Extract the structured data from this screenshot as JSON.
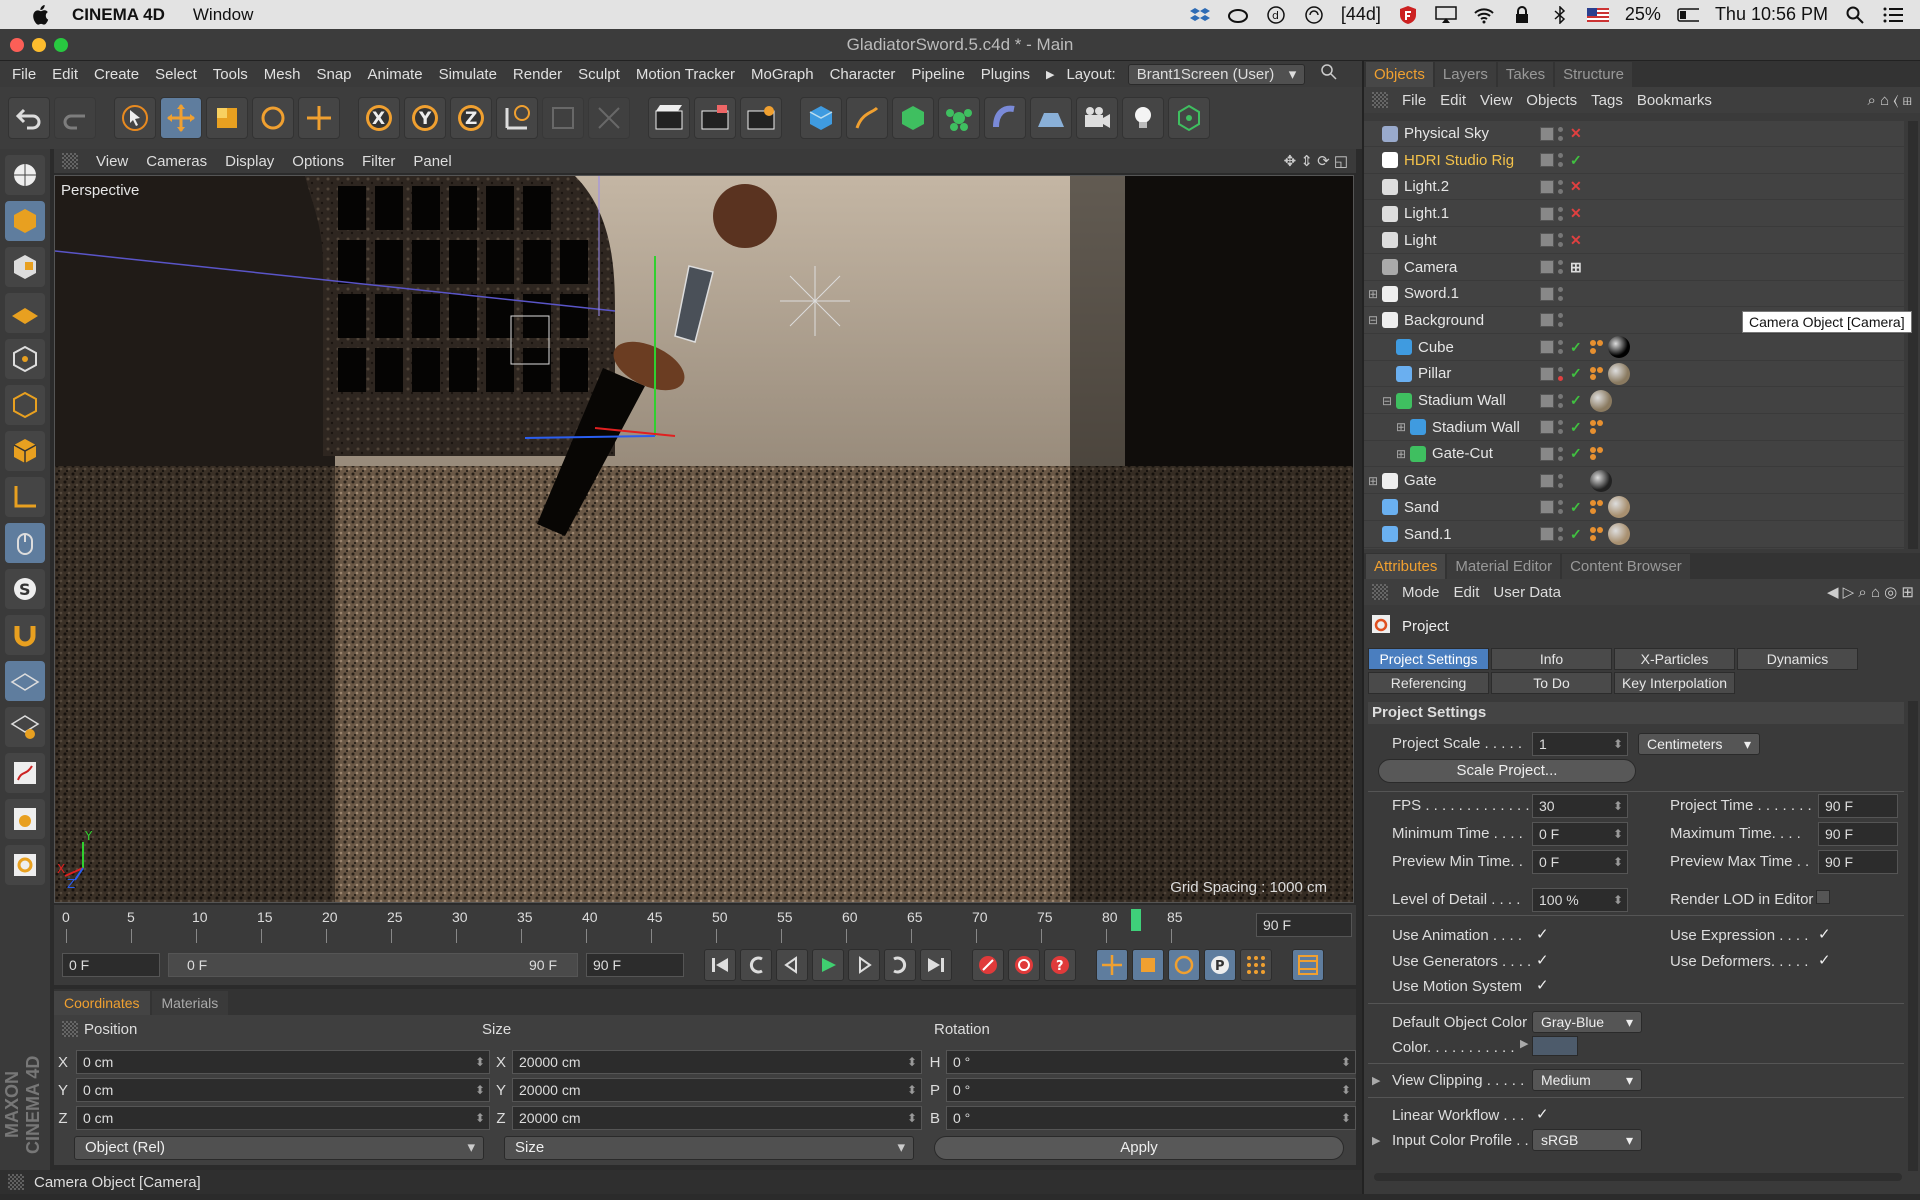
{
  "mac_menu": {
    "app_name": "CINEMA 4D",
    "window_menu": "Window",
    "status_44d": "[44d]",
    "battery": "25%",
    "clock": "Thu 10:56 PM"
  },
  "window": {
    "title": "GladiatorSword.5.c4d * - Main"
  },
  "main_menu": {
    "items": [
      "File",
      "Edit",
      "Create",
      "Select",
      "Tools",
      "Mesh",
      "Snap",
      "Animate",
      "Simulate",
      "Render",
      "Sculpt",
      "Motion Tracker",
      "MoGraph",
      "Character",
      "Pipeline",
      "Plugins"
    ],
    "layout_label": "Layout:",
    "layout_value": "Brant1Screen (User)"
  },
  "viewport_menu": {
    "items": [
      "View",
      "Cameras",
      "Display",
      "Options",
      "Filter",
      "Panel"
    ]
  },
  "viewport": {
    "label": "Perspective",
    "grid_spacing": "Grid Spacing : 1000 cm",
    "axis_y": "Y",
    "axis_x": "X",
    "axis_z": "Z"
  },
  "timeline": {
    "ticks": [
      "0",
      "5",
      "10",
      "15",
      "20",
      "25",
      "30",
      "35",
      "40",
      "45",
      "50",
      "55",
      "60",
      "65",
      "70",
      "75",
      "80",
      "85"
    ],
    "end_frame": "90 F",
    "current_frame_fraction": 0.91
  },
  "transport": {
    "start_field": "0 F",
    "range_start": "0 F",
    "range_end": "90 F",
    "end_field": "90 F"
  },
  "coord_tabs": {
    "coordinates": "Coordinates",
    "materials": "Materials"
  },
  "coords": {
    "position_header": "Position",
    "size_header": "Size",
    "rotation_header": "Rotation",
    "pos_labels": [
      "X",
      "Y",
      "Z"
    ],
    "pos_values": [
      "0 cm",
      "0 cm",
      "0 cm"
    ],
    "size_labels": [
      "X",
      "Y",
      "Z"
    ],
    "size_values": [
      "20000 cm",
      "20000 cm",
      "20000 cm"
    ],
    "rot_labels": [
      "H",
      "P",
      "B"
    ],
    "rot_values": [
      "0 °",
      "0 °",
      "0 °"
    ],
    "mode_dropdown": "Object (Rel)",
    "size_dropdown": "Size",
    "apply": "Apply"
  },
  "status": {
    "text": "Camera Object [Camera]"
  },
  "maxon": "MAXON CINEMA 4D",
  "objects_panel": {
    "tabs": [
      "Objects",
      "Layers",
      "Takes",
      "Structure"
    ],
    "menu": [
      "File",
      "Edit",
      "View",
      "Objects",
      "Tags",
      "Bookmarks"
    ],
    "rows": [
      {
        "name": "Physical Sky",
        "state": "✕",
        "state_color": "#e04040"
      },
      {
        "name": "HDRI Studio Rig",
        "state": "✓",
        "state_color": "#40c040"
      },
      {
        "name": "Light.2",
        "state": "✕",
        "state_color": "#e04040"
      },
      {
        "name": "Light.1",
        "state": "✕",
        "state_color": "#e04040"
      },
      {
        "name": "Light",
        "state": "✕",
        "state_color": "#e04040"
      },
      {
        "name": "Camera",
        "state": "⊞",
        "state_color": "#dddddd"
      },
      {
        "name": "Sword.1",
        "state": "",
        "state_color": "#dddddd"
      },
      {
        "name": "Background",
        "state": "",
        "state_color": "#dddddd"
      },
      {
        "name": "Cube",
        "state": "✓",
        "state_color": "#40c040"
      },
      {
        "name": "Pillar",
        "state": "✓",
        "state_color": "#40c040"
      },
      {
        "name": "Stadium Wall",
        "state": "✓",
        "state_color": "#40c040"
      },
      {
        "name": "Stadium Wall",
        "state": "✓",
        "state_color": "#40c040"
      },
      {
        "name": "Gate-Cut",
        "state": "✓",
        "state_color": "#40c040"
      },
      {
        "name": "Gate",
        "state": "",
        "state_color": "#dddddd"
      },
      {
        "name": "Sand",
        "state": "✓",
        "state_color": "#40c040"
      },
      {
        "name": "Sand.1",
        "state": "✓",
        "state_color": "#40c040"
      }
    ],
    "tooltip": "Camera Object [Camera]"
  },
  "attributes_panel": {
    "tabs": [
      "Attributes",
      "Material Editor",
      "Content Browser"
    ],
    "menu": [
      "Mode",
      "Edit",
      "User Data"
    ],
    "object_name": "Project",
    "subtabs": [
      "Project Settings",
      "Info",
      "X-Particles",
      "Dynamics",
      "Referencing",
      "To Do",
      "Key Interpolation"
    ],
    "section_title": "Project Settings",
    "project_scale_label": "Project Scale . . . . .",
    "project_scale_value": "1",
    "project_scale_unit": "Centimeters",
    "scale_project_button": "Scale Project...",
    "fps_label": "FPS . . . . . . . . . . . . .",
    "fps_value": "30",
    "project_time_label": "Project Time . . . . . . .",
    "project_time_value": "90 F",
    "min_time_label": "Minimum Time . . . .",
    "min_time_value": "0 F",
    "max_time_label": "Maximum Time. . . .",
    "max_time_value": "90 F",
    "prev_min_label": "Preview Min Time. .",
    "prev_min_value": "0 F",
    "prev_max_label": "Preview Max Time . .",
    "prev_max_value": "90 F",
    "lod_label": "Level of Detail . . . .",
    "lod_value": "100 %",
    "render_lod_label": "Render LOD in Editor",
    "use_animation_label": "Use Animation . . . .",
    "use_expression_label": "Use Expression . . . .",
    "use_generators_label": "Use Generators . . . .",
    "use_deformers_label": "Use Deformers. . . . .",
    "use_motion_label": "Use Motion System",
    "default_color_label": "Default Object Color",
    "default_color_value": "Gray-Blue",
    "color_label": "Color. . . . . . . . . . .",
    "view_clipping_label": "View Clipping . . . . .",
    "view_clipping_value": "Medium",
    "linear_workflow_label": "Linear Workflow . . .",
    "input_profile_label": "Input Color Profile . .",
    "input_profile_value": "sRGB",
    "check": "✓"
  }
}
